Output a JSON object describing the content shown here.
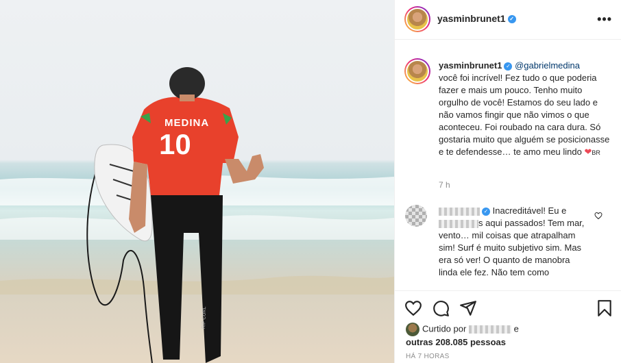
{
  "post": {
    "username": "yasminbrunet1",
    "verified_icon": "verified-badge-icon",
    "more_icon": "more-options-icon",
    "photo": {
      "jersey_name": "MEDINA",
      "jersey_number": "10",
      "wetsuit_brand": "RIP CURL"
    },
    "caption": {
      "username": "yasminbrunet1",
      "mention": "@gabrielmedina",
      "text": "você foi incrível! Fez tudo o que poderia fazer e mais um pouco. Tenho muito orgulho de você! Estamos do seu lado e não vamos fingir que não vimos o que aconteceu. Foi roubado na cara dura. Só gostaria muito que alguém se posicionasse e te defendesse… te amo meu lindo",
      "emoji_heart": "❤",
      "emoji_flag": "BR",
      "time": "7 h"
    },
    "comment": {
      "line1": "Inacreditável! Eu e",
      "line2": "s aqui passados! Tem mar, vento… mil coisas que atrapalham sim! Surf é muito subjetivo sim. Mas era só ver! O quanto de manobra linda ele fez. Não tem como"
    },
    "likes": {
      "prefix": "Curtido por",
      "suffix": "e",
      "others": "outras 208.085 pessoas"
    },
    "date": "HÁ 7 HORAS"
  },
  "icons": [
    "heart-icon",
    "comment-icon",
    "share-icon",
    "bookmark-icon"
  ],
  "colors": {
    "verified": "#3897f0",
    "mention": "#00376b",
    "muted": "#8e8e8e",
    "jersey": "#e8412c"
  }
}
